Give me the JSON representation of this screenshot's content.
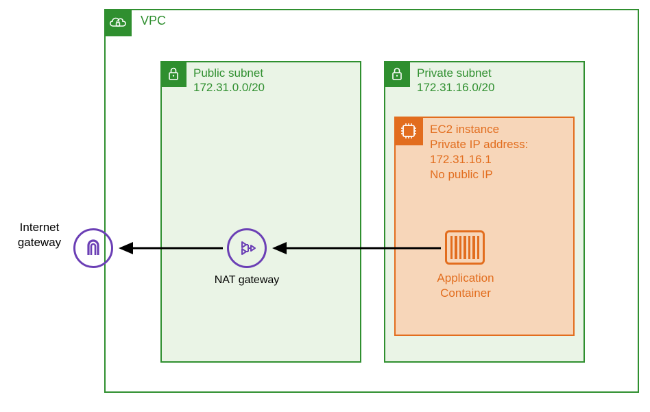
{
  "vpc": {
    "label": "VPC"
  },
  "public_subnet": {
    "title": "Public subnet",
    "cidr": "172.31.0.0/20"
  },
  "private_subnet": {
    "title": "Private subnet",
    "cidr": "172.31.16.0/20"
  },
  "ec2": {
    "title": "EC2 instance",
    "line2": "Private IP address:",
    "line3": "172.31.16.1",
    "line4": "No public IP"
  },
  "app_container": {
    "line1": "Application",
    "line2": "Container"
  },
  "nat": {
    "label": "NAT gateway"
  },
  "igw": {
    "line1": "Internet",
    "line2": "gateway"
  }
}
